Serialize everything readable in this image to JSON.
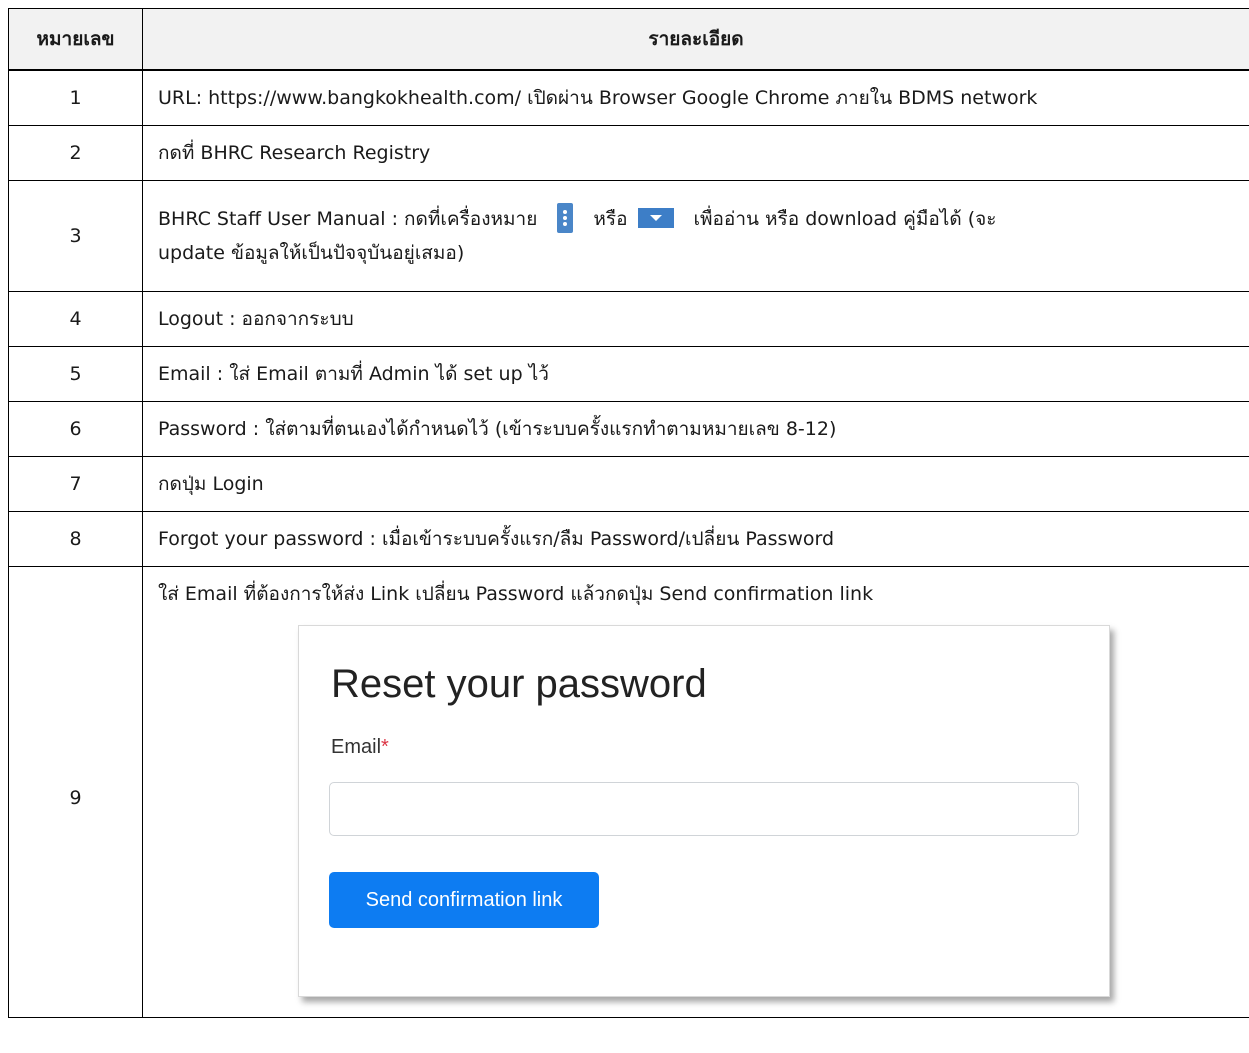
{
  "header": {
    "number": "หมายเลข",
    "detail": "รายละเอียด"
  },
  "rows": [
    {
      "number": "1",
      "text": "URL: https://www.bangkokhealth.com/ เปิดผ่าน Browser Google Chrome ภายใน BDMS network"
    },
    {
      "number": "2",
      "text": "กดที่ BHRC Research Registry"
    },
    {
      "number": "3",
      "text_before_icon1": "BHRC Staff User Manual  : กดที่เครื่องหมาย",
      "text_between_icons": "หรือ",
      "text_after_icon2": "เพื่ออ่าน หรือ download คู่มือได้ (จะ",
      "text_line2": "update ข้อมูลให้เป็นปัจจุบันอยู่เสมอ)",
      "icon1": "kebab-menu-icon",
      "icon2": "caret-down-icon",
      "icon_color": "#4a86c8"
    },
    {
      "number": "4",
      "text": "Logout : ออกจากระบบ"
    },
    {
      "number": "5",
      "text": "Email : ใส่ Email ตามที่ Admin ได้ set up ไว้"
    },
    {
      "number": "6",
      "text": "Password : ใส่ตามที่ตนเองได้กำหนดไว้ (เข้าระบบครั้งแรกทำตามหมายเลข 8-12)"
    },
    {
      "number": "7",
      "text": "กดปุ่ม Login"
    },
    {
      "number": "8",
      "text": "Forgot your password : เมื่อเข้าระบบครั้งแรก/ลืม Password/เปลี่ยน Password"
    },
    {
      "number": "9",
      "text": "ใส่ Email ที่ต้องการให้ส่ง Link เปลี่ยน Password แล้วกดปุ่ม Send confirmation link",
      "screenshot": {
        "title": "Reset your password",
        "email_label": "Email",
        "required_mark": "*",
        "email_value": "",
        "button_label": "Send confirmation link",
        "button_color": "#0d7cf2"
      }
    }
  ]
}
